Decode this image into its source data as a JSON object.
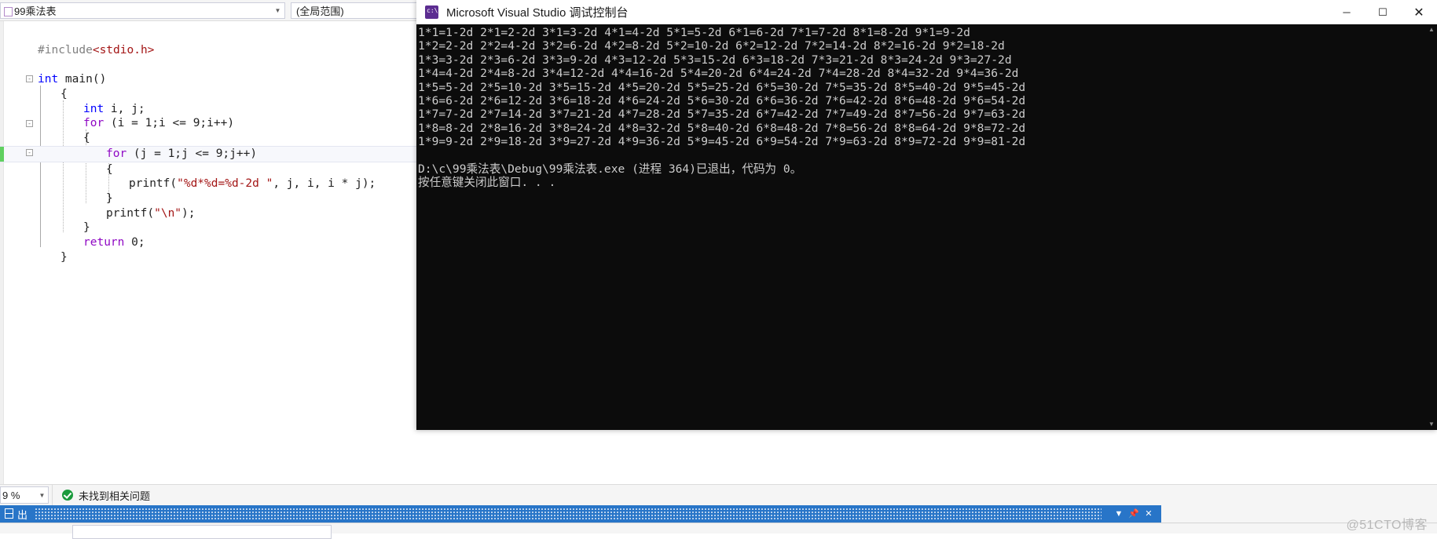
{
  "ide": {
    "navbar": {
      "project_combo": {
        "value": "99乘法表",
        "icon": "project-icon",
        "arrow": "▼"
      },
      "scope_combo": {
        "value": "(全局范围)",
        "arrow": "▼"
      }
    },
    "editor": {
      "lines": [
        {
          "indent": 0,
          "tokens": [
            {
              "t": "#include",
              "c": "pp"
            },
            {
              "t": "<stdio.h>",
              "c": "st"
            }
          ]
        },
        {
          "indent": 0,
          "tokens": []
        },
        {
          "indent": 0,
          "tokens": [
            {
              "t": "int",
              "c": "k"
            },
            {
              "t": " main()",
              "c": "id"
            }
          ]
        },
        {
          "indent": 1,
          "tokens": [
            {
              "t": "{",
              "c": "pn"
            }
          ]
        },
        {
          "indent": 2,
          "tokens": [
            {
              "t": "int",
              "c": "k"
            },
            {
              "t": " i, j;",
              "c": "id"
            }
          ]
        },
        {
          "indent": 2,
          "tokens": [
            {
              "t": "for",
              "c": "kc"
            },
            {
              "t": " (i = 1;i <= 9;i++)",
              "c": "id"
            }
          ]
        },
        {
          "indent": 2,
          "tokens": [
            {
              "t": "{",
              "c": "pn"
            }
          ]
        },
        {
          "indent": 3,
          "tokens": [
            {
              "t": "for",
              "c": "kc"
            },
            {
              "t": " (j = 1;j <= 9;j++)",
              "c": "id"
            }
          ]
        },
        {
          "indent": 3,
          "tokens": [
            {
              "t": "{",
              "c": "pn"
            }
          ]
        },
        {
          "indent": 4,
          "tokens": [
            {
              "t": "printf(",
              "c": "id"
            },
            {
              "t": "\"%d*%d=%d-2d \"",
              "c": "st"
            },
            {
              "t": ", j, i, i * j);",
              "c": "id"
            }
          ]
        },
        {
          "indent": 3,
          "tokens": [
            {
              "t": "}",
              "c": "pn"
            }
          ]
        },
        {
          "indent": 3,
          "tokens": [
            {
              "t": "printf(",
              "c": "id"
            },
            {
              "t": "\"\\n\"",
              "c": "st"
            },
            {
              "t": ");",
              "c": "id"
            }
          ]
        },
        {
          "indent": 2,
          "tokens": [
            {
              "t": "}",
              "c": "pn"
            }
          ]
        },
        {
          "indent": 2,
          "tokens": [
            {
              "t": "return",
              "c": "kc"
            },
            {
              "t": " 0;",
              "c": "id"
            }
          ]
        },
        {
          "indent": 1,
          "tokens": [
            {
              "t": "}",
              "c": "pn"
            }
          ]
        }
      ],
      "highlighted_line_index": 7,
      "change_bar_color": "#60d060"
    },
    "statusbar": {
      "zoom_value": "9 %",
      "zoom_arrow": "▼",
      "issues_text": "未找到相关问题",
      "issues_icon": "check-circle-icon"
    },
    "output_panel": {
      "tab_label": "出",
      "tab_icon": "output-window-icon",
      "controls": {
        "dropdown": "▼",
        "pin": "📌",
        "close": "✕"
      },
      "accent_color": "#2875c8"
    },
    "watermark": "@51CTO博客"
  },
  "console": {
    "title": "Microsoft Visual Studio 调试控制台",
    "icon": "console-app-icon",
    "window_buttons": {
      "minimize": "─",
      "maximize": "☐",
      "close": "✕"
    },
    "scrollbar": {
      "up_arrow": "▲",
      "down_arrow": "▼"
    },
    "output_lines": [
      "1*1=1-2d 2*1=2-2d 3*1=3-2d 4*1=4-2d 5*1=5-2d 6*1=6-2d 7*1=7-2d 8*1=8-2d 9*1=9-2d",
      "1*2=2-2d 2*2=4-2d 3*2=6-2d 4*2=8-2d 5*2=10-2d 6*2=12-2d 7*2=14-2d 8*2=16-2d 9*2=18-2d",
      "1*3=3-2d 2*3=6-2d 3*3=9-2d 4*3=12-2d 5*3=15-2d 6*3=18-2d 7*3=21-2d 8*3=24-2d 9*3=27-2d",
      "1*4=4-2d 2*4=8-2d 3*4=12-2d 4*4=16-2d 5*4=20-2d 6*4=24-2d 7*4=28-2d 8*4=32-2d 9*4=36-2d",
      "1*5=5-2d 2*5=10-2d 3*5=15-2d 4*5=20-2d 5*5=25-2d 6*5=30-2d 7*5=35-2d 8*5=40-2d 9*5=45-2d",
      "1*6=6-2d 2*6=12-2d 3*6=18-2d 4*6=24-2d 5*6=30-2d 6*6=36-2d 7*6=42-2d 8*6=48-2d 9*6=54-2d",
      "1*7=7-2d 2*7=14-2d 3*7=21-2d 4*7=28-2d 5*7=35-2d 6*7=42-2d 7*7=49-2d 8*7=56-2d 9*7=63-2d",
      "1*8=8-2d 2*8=16-2d 3*8=24-2d 4*8=32-2d 5*8=40-2d 6*8=48-2d 7*8=56-2d 8*8=64-2d 9*8=72-2d",
      "1*9=9-2d 2*9=18-2d 3*9=27-2d 4*9=36-2d 5*9=45-2d 6*9=54-2d 7*9=63-2d 8*9=72-2d 9*9=81-2d",
      "",
      "D:\\c\\99乘法表\\Debug\\99乘法表.exe (进程 364)已退出，代码为 0。",
      "按任意键关闭此窗口. . ."
    ]
  }
}
